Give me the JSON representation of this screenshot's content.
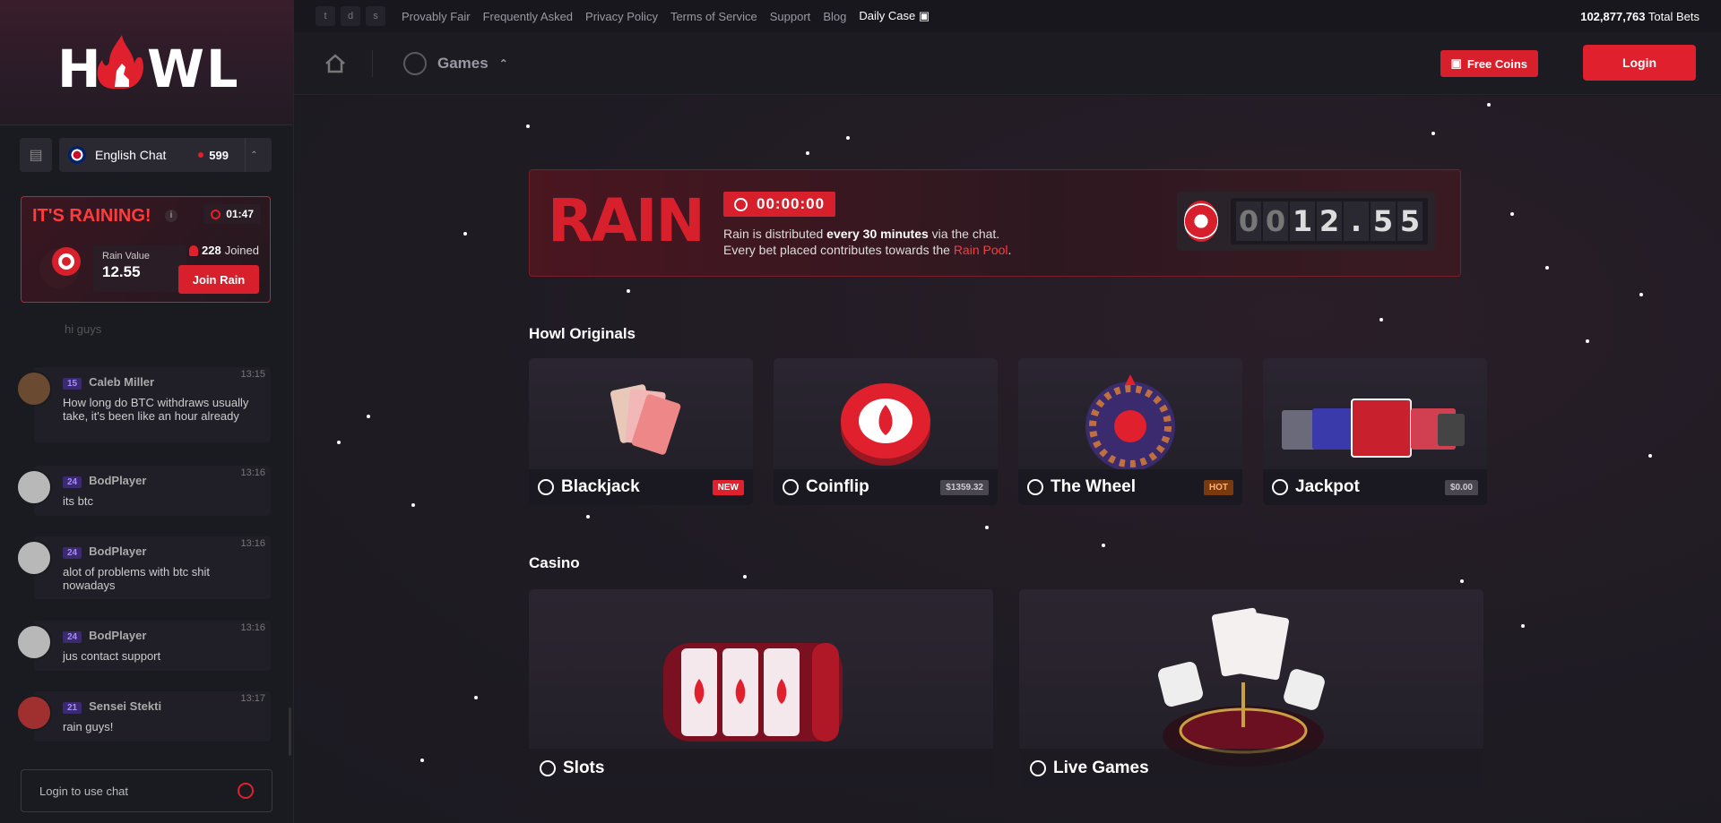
{
  "sidebar": {
    "logo": "HOWL",
    "chat_room": "English Chat",
    "online_count": "599",
    "rain": {
      "title": "IT'S RAINING!",
      "info": "i",
      "timer": "01:47",
      "value_label": "Rain Value",
      "value": "12.55",
      "joined_count": "228",
      "joined_label": "Joined",
      "join_button": "Join Rain"
    },
    "ghost_message": "hi guys",
    "messages": [
      {
        "level": "15",
        "user": "Caleb Miller",
        "time": "13:15",
        "text": "How long do BTC withdraws usually take, it's been like an hour already"
      },
      {
        "level": "24",
        "user": "BodPlayer",
        "time": "13:16",
        "text": "its btc"
      },
      {
        "level": "24",
        "user": "BodPlayer",
        "time": "13:16",
        "text": "alot of problems with btc shit nowadays"
      },
      {
        "level": "24",
        "user": "BodPlayer",
        "time": "13:16",
        "text": "jus contact support"
      },
      {
        "level": "21",
        "user": "Sensei Stekti",
        "time": "13:17",
        "text": "rain guys!"
      }
    ],
    "chat_input_placeholder": "Login to use chat"
  },
  "topbar": {
    "links": [
      "Provably Fair",
      "Frequently Asked",
      "Privacy Policy",
      "Terms of Service",
      "Support",
      "Blog"
    ],
    "daily_case": "Daily Case",
    "total_bets_value": "102,877,763",
    "total_bets_label": "Total Bets"
  },
  "header": {
    "games_label": "Games",
    "free_coins": "Free Coins",
    "login": "Login"
  },
  "banner": {
    "title": "RAIN",
    "timer": "00:00:00",
    "line1_pre": "Rain is distributed ",
    "line1_bold": "every 30 minutes",
    "line1_post": " via the chat.",
    "line2_pre": "Every bet placed contributes towards the ",
    "line2_link": "Rain Pool",
    "line2_post": ".",
    "counter_digits": [
      "0",
      "0",
      "1",
      "2",
      ".",
      "5",
      "5"
    ]
  },
  "originals": {
    "title": "Howl Originals",
    "games": [
      {
        "name": "Blackjack",
        "tag": "NEW"
      },
      {
        "name": "Coinflip",
        "tag": "$1359.32"
      },
      {
        "name": "The Wheel",
        "tag": "HOT"
      },
      {
        "name": "Jackpot",
        "tag": "$0.00"
      }
    ]
  },
  "casino": {
    "title": "Casino",
    "games": [
      {
        "name": "Slots"
      },
      {
        "name": "Live Games"
      }
    ]
  },
  "colors": {
    "accent": "#e0202c",
    "bg": "#1b1a22"
  }
}
